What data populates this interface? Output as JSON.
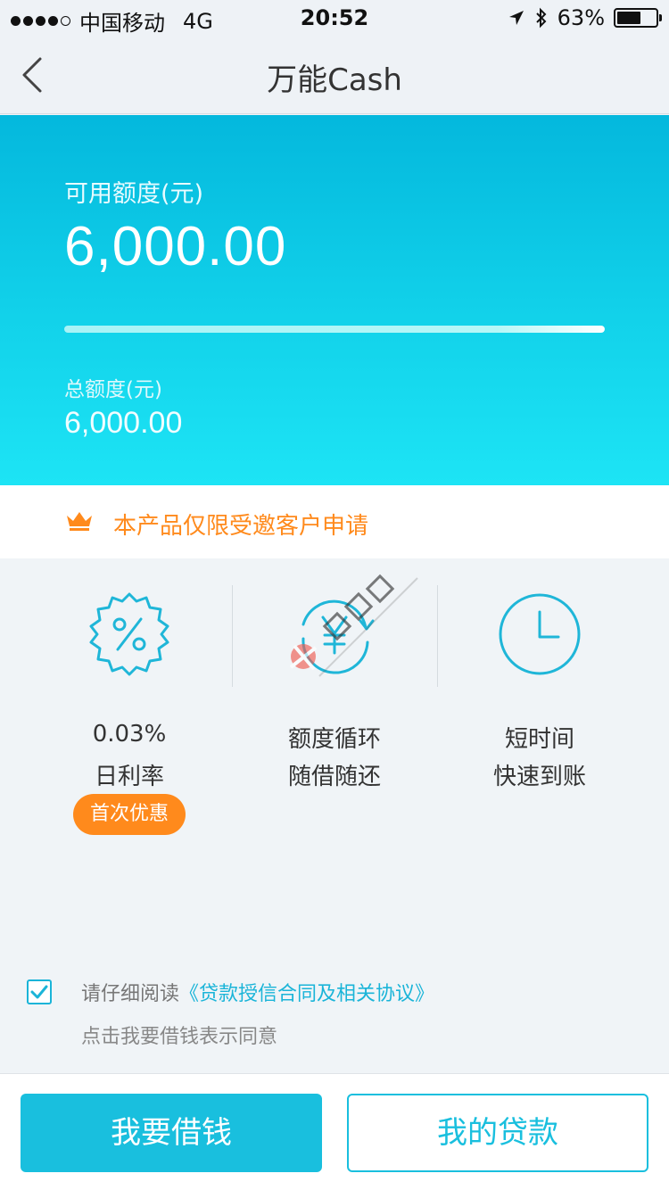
{
  "status_bar": {
    "carrier": "中国移动",
    "network": "4G",
    "time": "20:52",
    "battery_percent": "63%",
    "battery_level": 0.63
  },
  "nav": {
    "title": "万能Cash",
    "back_icon": "chevron-left-icon"
  },
  "credit": {
    "available_label": "可用额度(元)",
    "available_amount": "6,000.00",
    "usage_fraction": 1.0,
    "total_label": "总额度(元)",
    "total_amount": "6,000.00"
  },
  "notice": {
    "icon": "crown-icon",
    "text": "本产品仅限受邀客户申请"
  },
  "features": [
    {
      "icon": "percent-badge-icon",
      "line1": "0.03%",
      "line2": "日利率",
      "badge": "首次优惠"
    },
    {
      "icon": "yuan-cycle-icon",
      "line1": "额度循环",
      "line2": "随借随还"
    },
    {
      "icon": "clock-icon",
      "line1": "短时间",
      "line2": "快速到账"
    }
  ],
  "agreement": {
    "checked": true,
    "prefix": "请仔细阅读",
    "link_text": "《贷款授信合同及相关协议》",
    "note": "点击我要借钱表示同意"
  },
  "actions": {
    "borrow_label": "我要借钱",
    "my_loans_label": "我的贷款"
  },
  "colors": {
    "accent": "#19bfde",
    "orange": "#ff8a1c",
    "hero_top": "#04b8dd",
    "hero_bottom": "#1de4f5"
  }
}
